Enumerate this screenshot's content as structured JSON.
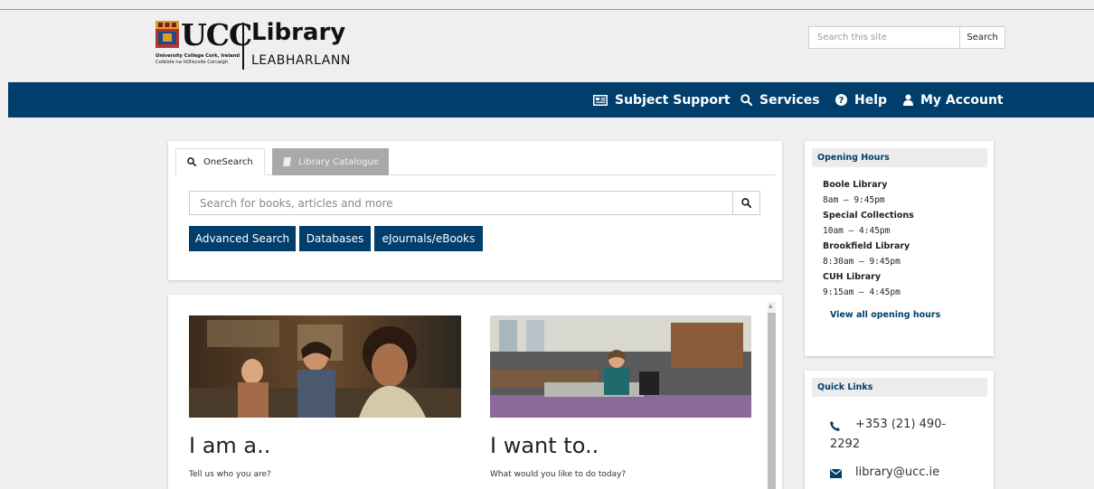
{
  "header": {
    "brand": "UCC",
    "brand_sub1": "University College Cork, Ireland",
    "brand_sub2": "Coláiste na hOllscoile Corcaigh",
    "library_title": "Library",
    "library_sub": "LEABHARLANN",
    "site_search": {
      "placeholder": "Search this site",
      "button_label": "Search"
    }
  },
  "nav": {
    "items": [
      {
        "label": "Subject Support",
        "icon": "newspaper-icon"
      },
      {
        "label": "Services",
        "icon": "search-icon"
      },
      {
        "label": "Help",
        "icon": "question-circle-icon"
      },
      {
        "label": "My Account",
        "icon": "user-icon"
      }
    ]
  },
  "search_panel": {
    "tabs": [
      {
        "label": "OneSearch",
        "icon": "search-icon",
        "active": true
      },
      {
        "label": "Library Catalogue",
        "icon": "book-icon",
        "active": false
      }
    ],
    "input_placeholder": "Search for books, articles and more",
    "buttons": [
      "Advanced Search",
      "Databases",
      "eJournals/eBooks"
    ]
  },
  "cards": [
    {
      "title": "I am a..",
      "subtitle": "Tell us who you are?"
    },
    {
      "title": "I want to..",
      "subtitle": "What would you like to do today?"
    }
  ],
  "opening_hours": {
    "heading": "Opening Hours",
    "locations": [
      {
        "name": "Boole Library",
        "hours": "8am – 9:45pm"
      },
      {
        "name": "Special Collections",
        "hours": "10am – 4:45pm"
      },
      {
        "name": "Brookfield Library",
        "hours": "8:30am – 9:45pm"
      },
      {
        "name": "CUH Library",
        "hours": "9:15am – 4:45pm"
      }
    ],
    "view_all": "View all opening hours"
  },
  "quick_links": {
    "heading": "Quick Links",
    "phone_line1": "+353 (21) 490-",
    "phone_line2": "2292",
    "email": "library@ucc.ie"
  },
  "colors": {
    "brand_blue": "#003e6b",
    "tab_inactive": "#a9a9a9",
    "background": "#efefef"
  }
}
